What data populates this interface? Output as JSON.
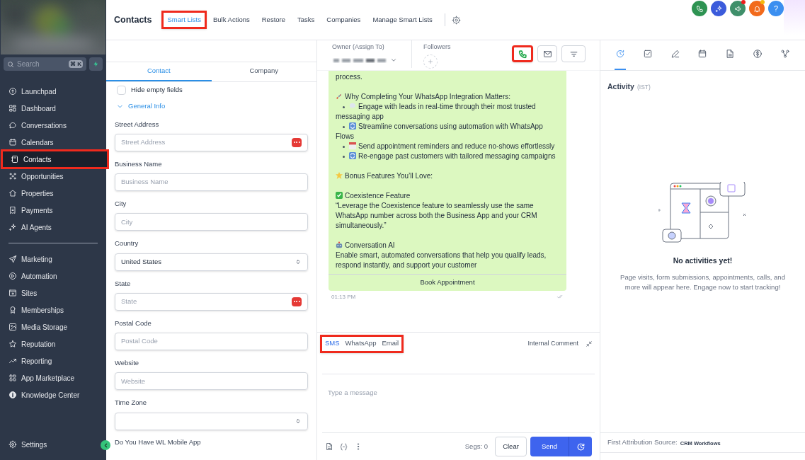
{
  "sidebar": {
    "search": {
      "placeholder": "Search",
      "shortcut": "⌘ K"
    },
    "groups": [
      [
        {
          "label": "Launchpad",
          "selected": false,
          "highlighted": false
        },
        {
          "label": "Dashboard",
          "selected": false,
          "highlighted": false
        },
        {
          "label": "Conversations",
          "selected": false,
          "highlighted": false
        },
        {
          "label": "Calendars",
          "selected": false,
          "highlighted": false
        },
        {
          "label": "Contacts",
          "selected": true,
          "highlighted": true
        },
        {
          "label": "Opportunities",
          "selected": false,
          "highlighted": false
        },
        {
          "label": "Properties",
          "selected": false,
          "highlighted": false
        },
        {
          "label": "Payments",
          "selected": false,
          "highlighted": false
        },
        {
          "label": "AI Agents",
          "selected": false,
          "highlighted": false
        }
      ],
      [
        {
          "label": "Marketing",
          "selected": false,
          "highlighted": false
        },
        {
          "label": "Automation",
          "selected": false,
          "highlighted": false
        },
        {
          "label": "Sites",
          "selected": false,
          "highlighted": false
        },
        {
          "label": "Memberships",
          "selected": false,
          "highlighted": false
        },
        {
          "label": "Media Storage",
          "selected": false,
          "highlighted": false
        },
        {
          "label": "Reputation",
          "selected": false,
          "highlighted": false
        },
        {
          "label": "Reporting",
          "selected": false,
          "highlighted": false
        },
        {
          "label": "App Marketplace",
          "selected": false,
          "highlighted": false
        },
        {
          "label": "Knowledge Center",
          "selected": false,
          "highlighted": false
        }
      ]
    ],
    "settings": "Settings"
  },
  "header": {
    "title": "Contacts",
    "tabs": [
      {
        "label": "Smart Lists",
        "selected": true,
        "highlighted": true
      },
      {
        "label": "Bulk Actions",
        "selected": false,
        "highlighted": false
      },
      {
        "label": "Restore",
        "selected": false,
        "highlighted": false
      },
      {
        "label": "Tasks",
        "selected": false,
        "highlighted": false
      },
      {
        "label": "Companies",
        "selected": false,
        "highlighted": false
      },
      {
        "label": "Manage Smart Lists",
        "selected": false,
        "highlighted": false
      }
    ]
  },
  "top_actions": [
    {
      "kind": "phone",
      "color": "#2e9352",
      "badge": false
    },
    {
      "kind": "sparkle",
      "color": "#3b5bdb",
      "badge": false
    },
    {
      "kind": "megaphone",
      "color": "#3f8f6a",
      "badge": true
    },
    {
      "kind": "bell",
      "color": "#f26a1b",
      "badge": true
    },
    {
      "kind": "help",
      "color": "#3b8ff0",
      "badge": false,
      "label": "?"
    }
  ],
  "details": {
    "tabs": [
      {
        "label": "Contact",
        "selected": true
      },
      {
        "label": "Company",
        "selected": false
      }
    ],
    "hide_empty": {
      "label": "Hide empty fields",
      "checked": false
    },
    "section": {
      "label": "General Info",
      "expanded": true
    },
    "fields": [
      {
        "label": "Street Address",
        "kind": "text",
        "placeholder": "Street Address",
        "action": true
      },
      {
        "label": "Business Name",
        "kind": "text",
        "placeholder": "Business Name",
        "action": false
      },
      {
        "label": "City",
        "kind": "text",
        "placeholder": "City",
        "action": false
      },
      {
        "label": "Country",
        "kind": "select",
        "value": "United States"
      },
      {
        "label": "State",
        "kind": "text",
        "placeholder": "State",
        "action": true
      },
      {
        "label": "Postal Code",
        "kind": "text",
        "placeholder": "Postal Code",
        "action": false
      },
      {
        "label": "Website",
        "kind": "text",
        "placeholder": "Website",
        "action": false
      },
      {
        "label": "Time Zone",
        "kind": "select"
      }
    ],
    "next_label": "Do You Have WL Mobile App"
  },
  "conversation": {
    "owner_label": "Owner (Assign To)",
    "followers_label": "Followers",
    "actions": [
      {
        "kind": "call",
        "highlighted": true
      },
      {
        "kind": "email",
        "highlighted": false
      },
      {
        "kind": "filter",
        "highlighted": false
      }
    ],
    "message": {
      "lines": [
        {
          "kind": "text",
          "text": "process."
        },
        {
          "kind": "blank"
        },
        {
          "kind": "emoji",
          "text": "Why Completing Your WhatsApp Integration Matters:"
        },
        {
          "kind": "bullet",
          "text": "Engage with leads in real-time through their most trusted messaging app"
        },
        {
          "kind": "bullet",
          "text": "Streamline conversations using automation with WhatsApp Flows"
        },
        {
          "kind": "bullet",
          "text": "Send appointment reminders and reduce no-shows effortlessly"
        },
        {
          "kind": "bullet",
          "text": "Re-engage past customers with tailored messaging campaigns"
        },
        {
          "kind": "blank"
        },
        {
          "kind": "emoji",
          "text": "Bonus Features You’ll Love:"
        },
        {
          "kind": "blank"
        },
        {
          "kind": "emoji",
          "text": "Coexistence Feature"
        },
        {
          "kind": "text",
          "text": "“Leverage the Coexistence feature to seamlessly use the same WhatsApp number across both the Business App and your CRM simultaneously.”"
        },
        {
          "kind": "blank"
        },
        {
          "kind": "emoji",
          "text": "Conversation AI"
        },
        {
          "kind": "text",
          "text": "Enable smart, automated conversations that help you qualify leads, respond instantly, and support your customer"
        }
      ],
      "button": "Book Appointment",
      "time": "01:13 PM"
    },
    "composer": {
      "channels": [
        {
          "label": "SMS",
          "selected": true
        },
        {
          "label": "WhatsApp",
          "selected": false
        },
        {
          "label": "Email",
          "selected": false
        }
      ],
      "channels_highlighted": true,
      "internal_comment": "Internal Comment",
      "placeholder": "Type a message",
      "segs": "Segs: 0",
      "clear": "Clear",
      "send": "Send"
    }
  },
  "activity": {
    "tabs": [
      {
        "selected": true
      },
      {
        "selected": false
      },
      {
        "selected": false
      },
      {
        "selected": false
      },
      {
        "selected": false
      },
      {
        "selected": false
      },
      {
        "selected": false
      }
    ],
    "title": "Activity",
    "timezone": "(IST)",
    "empty_title": "No activities yet!",
    "empty_text": "Page visits, form submissions, appointments, calls, and more will appear here. Engage now to start tracking!",
    "attribution_label": "First Attribution Source:",
    "attribution_value": "CRM Workflows"
  }
}
